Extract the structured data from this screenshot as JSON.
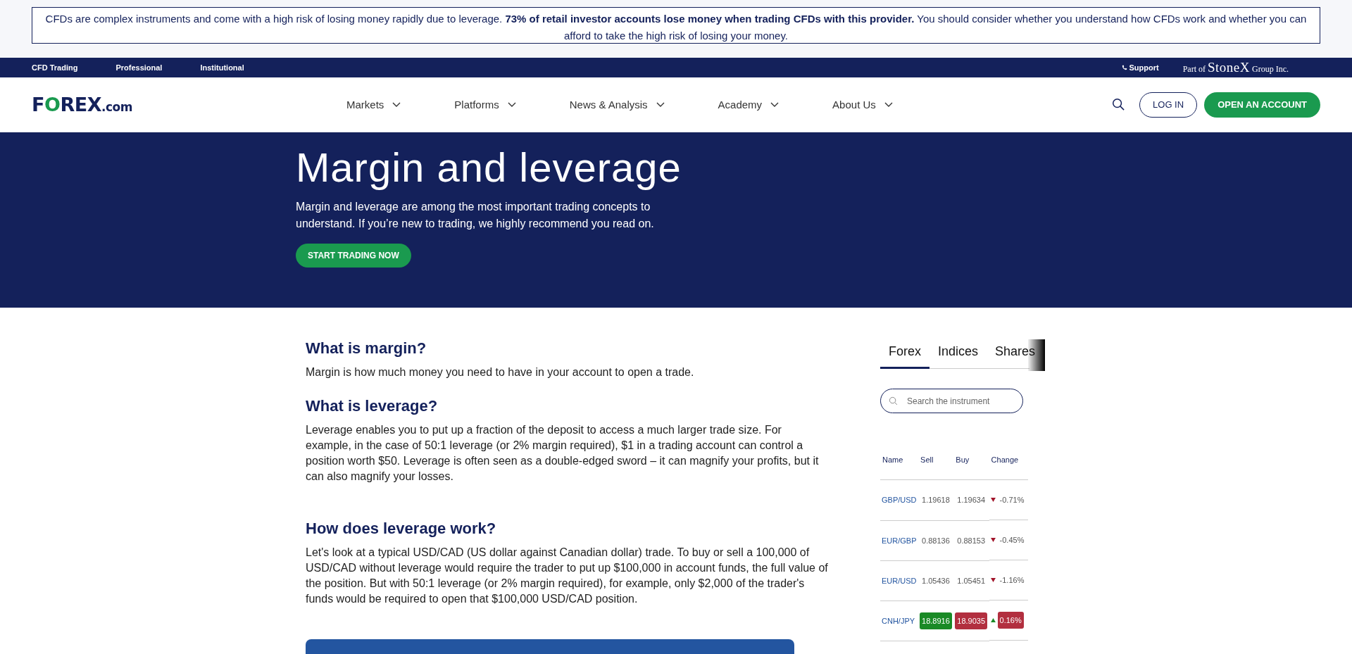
{
  "risk_warning": "CFDs are complex instruments and come with a high risk of losing money rapidly due to leverage. **73% of retail investor accounts lose money when trading CFDs with this provider.** You should consider whether you understand how CFDs work and whether you can afford to take the high risk of losing your money.",
  "top_bar": {
    "links": [
      "CFD Trading",
      "Professional",
      "Institutional"
    ],
    "support": "Support",
    "partner": {
      "prefix": "Part of",
      "brand": "StoneX",
      "suffix": "Group Inc."
    }
  },
  "header": {
    "logo": {
      "text": "FOREX",
      "suffix": ".com"
    },
    "nav": [
      {
        "label": "Markets"
      },
      {
        "label": "Platforms"
      },
      {
        "label": "News & Analysis"
      },
      {
        "label": "Academy"
      },
      {
        "label": "About Us"
      }
    ],
    "login": "LOG IN",
    "open_account": "OPEN AN ACCOUNT"
  },
  "hero": {
    "title": "Margin and leverage",
    "text": "Margin and leverage are among the most important trading concepts to understand. If you’re new to trading, we highly recommend you read on.",
    "button": "START TRADING NOW"
  },
  "article": [
    {
      "heading": "What is margin?",
      "text": "Margin is how much money you need to have in your account to open a trade."
    },
    {
      "heading": "What is leverage?",
      "text": "Leverage enables you to put up a fraction of the deposit to access a much larger trade size.  For example, in the case of 50:1 leverage (or 2% margin required), $1 in a trading account can control a position worth $50. Leverage is often seen as a double-edged sword – it can magnify your profits, but it can also magnify your losses."
    },
    {
      "heading": "How does leverage work?",
      "text": "Let's look at a typical USD/CAD (US dollar against Canadian dollar) trade. To buy or sell a 100,000 of USD/CAD without leverage would require the trader to put up $100,000 in account funds, the full value of the position. But with 50:1 leverage (or 2% margin required), for example, only $2,000 of the trader's funds would be required to open that $100,000 USD/CAD position."
    }
  ],
  "sidebar": {
    "tabs": [
      {
        "label": "Forex",
        "selected": true
      },
      {
        "label": "Indices",
        "selected": false
      },
      {
        "label": "Shares",
        "selected": false
      }
    ],
    "search": {
      "placeholder": "Search the instrument"
    },
    "columns": [
      "Name",
      "Sell",
      "Buy",
      "Change"
    ],
    "rows": [
      {
        "name": "GBP/USD",
        "sell": "1.19618",
        "buy": "1.19634",
        "change": "-0.71%",
        "rising": false,
        "highlighted": false
      },
      {
        "name": "EUR/GBP",
        "sell": "0.88136",
        "buy": "0.88153",
        "change": "-0.45%",
        "rising": false,
        "highlighted": false
      },
      {
        "name": "EUR/USD",
        "sell": "1.05436",
        "buy": "1.05451",
        "change": "-1.16%",
        "rising": false,
        "highlighted": false
      },
      {
        "name": "CNH/JPY",
        "sell": "18.8916",
        "buy": "18.9035",
        "change": "0.16%",
        "rising": true,
        "highlighted": true
      }
    ]
  }
}
